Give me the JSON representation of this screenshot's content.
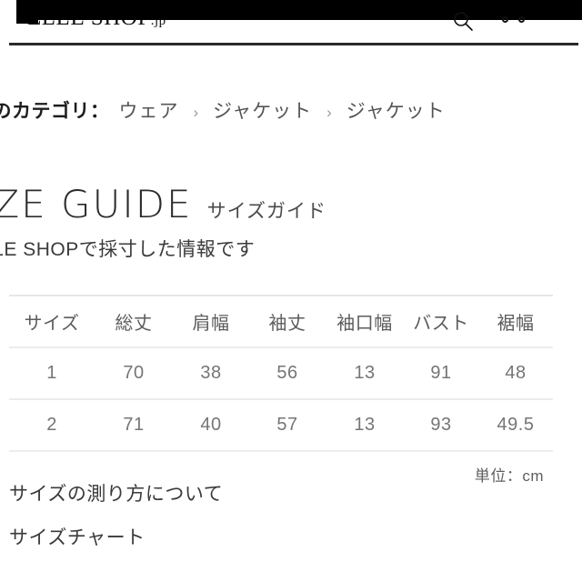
{
  "header": {
    "logo": "ELLE SHOP",
    "logo_suffix": ".jp",
    "search_icon": "search-icon",
    "menu_icon": "menu-dots-icon"
  },
  "breadcrumb": {
    "label": "品のカテゴリ：",
    "items": [
      "ウェア",
      "ジャケット",
      "ジャケット"
    ],
    "separator": "›"
  },
  "size_guide": {
    "title_en": "IZE GUIDE",
    "title_ja": "サイズガイド",
    "subtitle": "LLE SHOPで採寸した情報です",
    "unit_note": "単位：cm"
  },
  "table": {
    "headers": [
      "サイズ",
      "総丈",
      "肩幅",
      "袖丈",
      "袖口幅",
      "バスト",
      "裾幅"
    ],
    "rows": [
      [
        "1",
        "70",
        "38",
        "56",
        "13",
        "91",
        "48"
      ],
      [
        "2",
        "71",
        "40",
        "57",
        "13",
        "93",
        "49.5"
      ]
    ]
  },
  "links": [
    {
      "label": "サイズの測り方について"
    },
    {
      "label": "サイズチャート"
    }
  ],
  "colors": {
    "background": "#ffffff",
    "text": "#333333",
    "muted": "#757575",
    "rule": "#2a2a2a",
    "border": "#ececec",
    "overlay": "#000000",
    "scrollbar": "#bdbdbd"
  }
}
